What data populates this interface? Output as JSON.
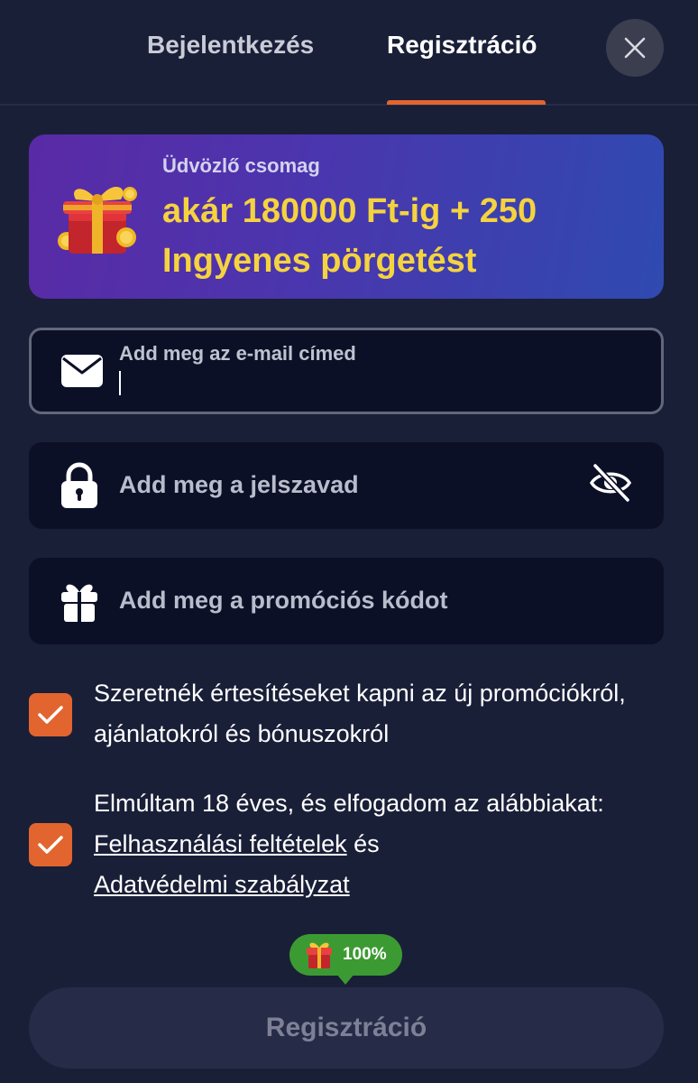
{
  "tabs": {
    "login_label": "Bejelentkezés",
    "register_label": "Regisztráció",
    "active": "register"
  },
  "banner": {
    "subtitle": "Üdvözlő csomag",
    "headline": "akár 180000 Ft-ig + 250 Ingyenes pörgetést",
    "icon": "gift-box-with-coins-icon"
  },
  "form": {
    "email": {
      "label": "Add meg az e-mail címed",
      "value": "",
      "icon": "envelope-icon"
    },
    "password": {
      "placeholder": "Add meg a jelszavad",
      "icon": "lock-icon",
      "toggle_icon": "eye-slash-icon"
    },
    "promo": {
      "placeholder": "Add meg a promóciós kódot",
      "icon": "gift-icon"
    }
  },
  "checkboxes": {
    "notifications": {
      "checked": true,
      "text": "Szeretnék értesítéseket kapni az új promóciókról, ajánlatokról és bónuszokról"
    },
    "terms": {
      "checked": true,
      "text_before": "Elmúltam 18 éves, és elfogadom az alábbiakat: ",
      "link_terms": "Felhasználási feltételek",
      "text_between": " és ",
      "link_privacy": "Adatvédelmi szabályzat"
    }
  },
  "bonus_badge": {
    "value": "100%",
    "icon": "gift-icon"
  },
  "submit": {
    "label": "Regisztráció",
    "enabled": false
  },
  "colors": {
    "background": "#1a1f38",
    "accent": "#e2652f",
    "field_bg": "#0c1027",
    "banner_text": "#f5d33f",
    "badge": "#3c9a32"
  }
}
